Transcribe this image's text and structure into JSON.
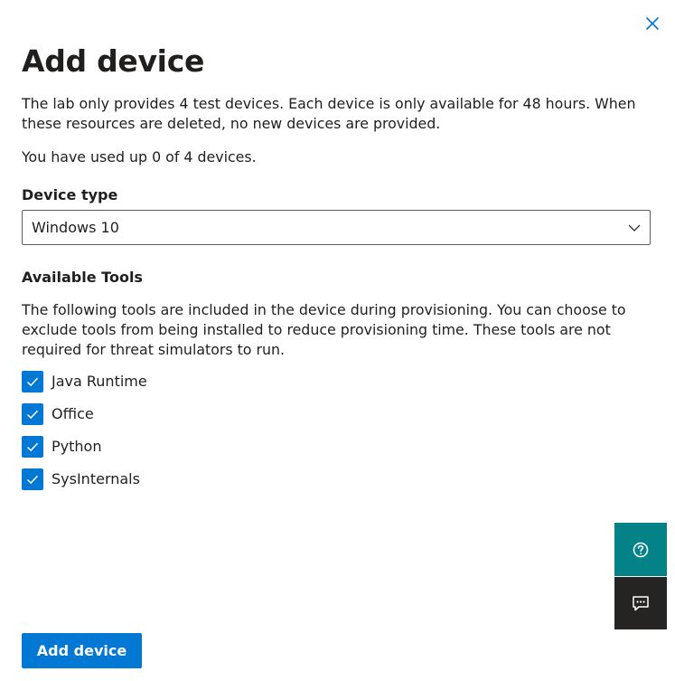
{
  "dialog": {
    "title": "Add device",
    "intro": "The lab only provides 4 test devices. Each device is only available for 48 hours. When these resources are deleted, no new devices are provided.",
    "usage": "You have used up 0 of 4 devices.",
    "close_icon": "close-icon"
  },
  "device_type": {
    "label": "Device type",
    "selected": "Windows 10",
    "chevron_icon": "chevron-down-icon"
  },
  "tools": {
    "label": "Available Tools",
    "description": "The following tools are included in the device during provisioning. You can choose to exclude tools from being installed to reduce provisioning time. These tools are not required for threat simulators to run.",
    "items": [
      {
        "label": "Java Runtime",
        "checked": true
      },
      {
        "label": "Office",
        "checked": true
      },
      {
        "label": "Python",
        "checked": true
      },
      {
        "label": "SysInternals",
        "checked": true
      }
    ]
  },
  "side_actions": {
    "help_icon": "help-circle-icon",
    "feedback_icon": "feedback-icon"
  },
  "footer": {
    "primary_label": "Add device"
  },
  "colors": {
    "accent": "#0078d4",
    "help_button": "#038387",
    "feedback_button": "#252423",
    "text": "#201f1e"
  }
}
